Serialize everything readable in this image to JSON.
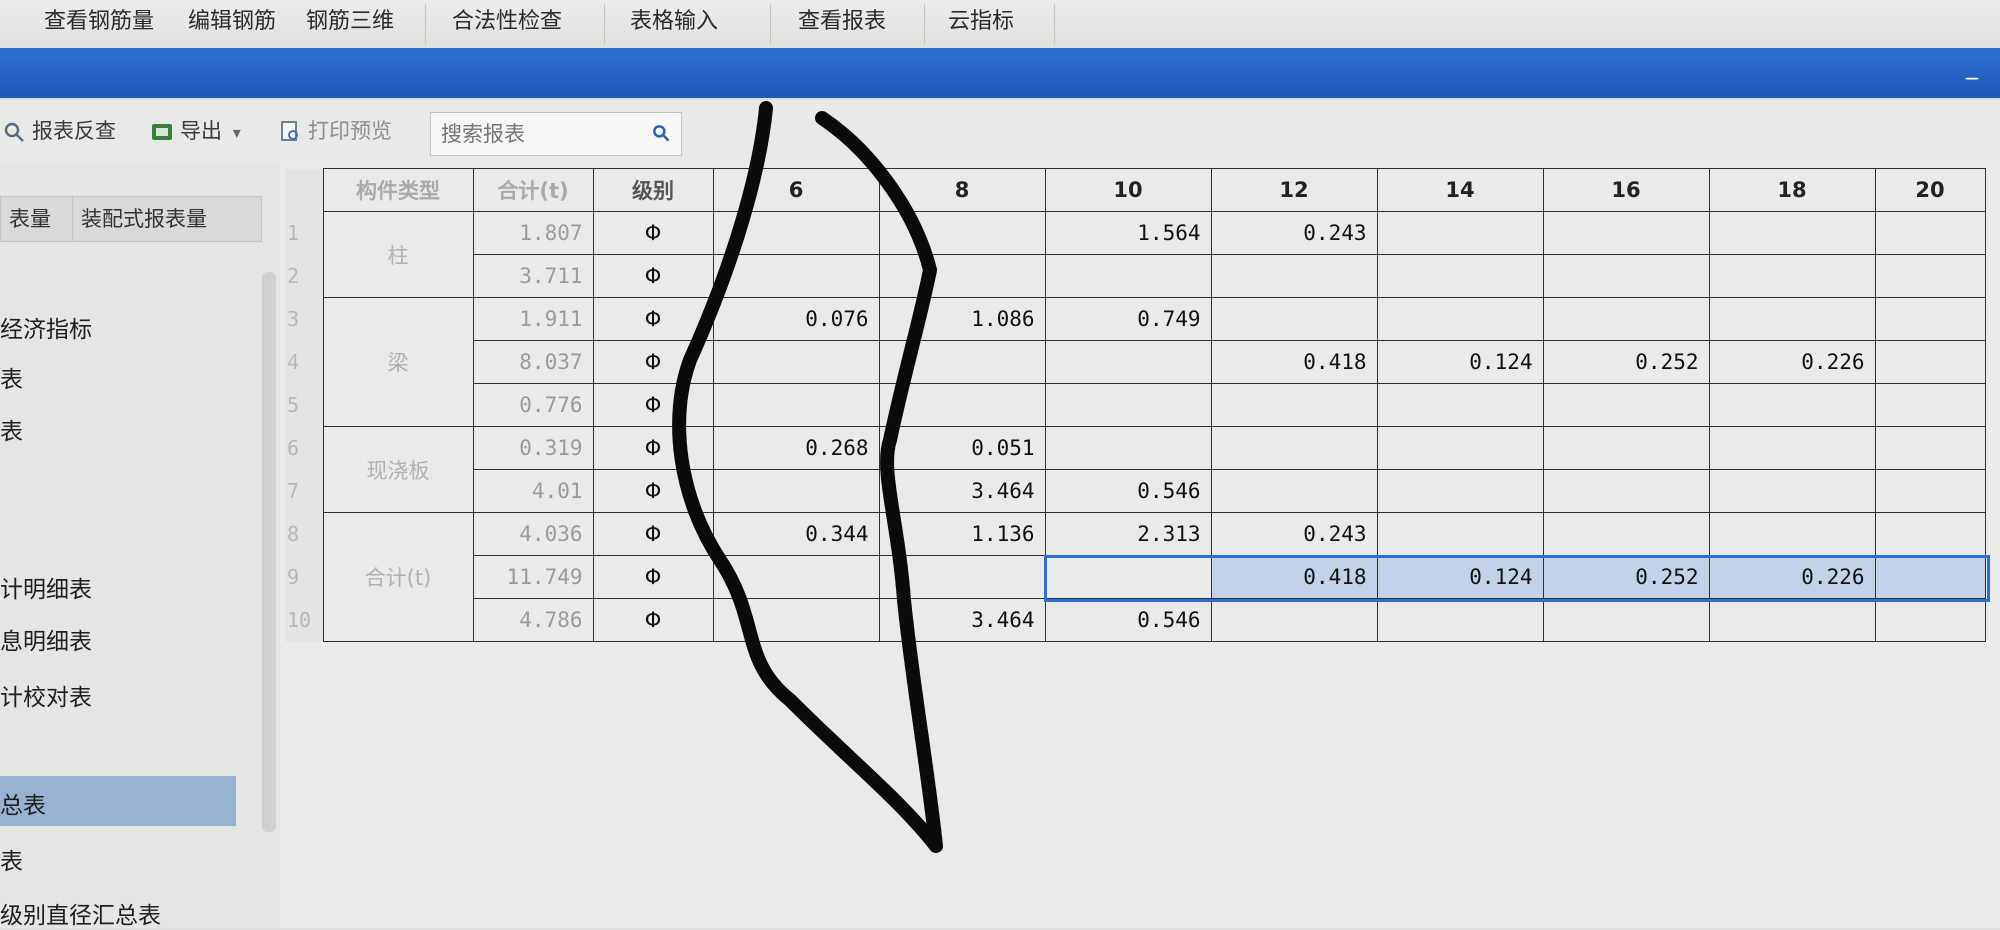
{
  "menu": [
    "查看钢筋量",
    "编辑钢筋",
    "钢筋三维",
    "合法性检查",
    "表格输入",
    "查看报表",
    "云指标"
  ],
  "window": {
    "minimize_label": "_"
  },
  "toolbar": {
    "report_query": "报表反查",
    "export": "导出",
    "export_arrow": "▾",
    "print_preview": "打印预览",
    "search_placeholder": "搜索报表"
  },
  "left_panel": {
    "tabs": [
      "表量",
      "装配式报表量"
    ],
    "items": [
      "经济指标",
      "表",
      "表",
      "计明细表",
      "息明细表",
      "计校对表",
      "总表",
      "表",
      "级别直径汇总表"
    ],
    "selected_index": 6
  },
  "table": {
    "headers": {
      "row_header": "构件类型",
      "total": "合计(t)",
      "grade": "级别",
      "diameters": [
        "6",
        "8",
        "10",
        "12",
        "14",
        "16",
        "18",
        "20"
      ]
    },
    "groups": [
      {
        "name": "柱",
        "first_row": 0,
        "span": 2
      },
      {
        "name": "梁",
        "first_row": 2,
        "span": 3
      },
      {
        "name": "现浇板",
        "first_row": 5,
        "span": 2
      },
      {
        "name": "合计(t)",
        "first_row": 7,
        "span": 3
      }
    ],
    "rows": [
      {
        "num": "1",
        "total": "1.807",
        "grade": "Φ",
        "values": [
          "",
          "",
          "1.564",
          "0.243",
          "",
          "",
          "",
          ""
        ]
      },
      {
        "num": "2",
        "total": "3.711",
        "grade": "Φ",
        "values": [
          "",
          "",
          "",
          "",
          "",
          "",
          "",
          ""
        ]
      },
      {
        "num": "3",
        "total": "1.911",
        "grade": "Φ",
        "values": [
          "0.076",
          "1.086",
          "0.749",
          "",
          "",
          "",
          "",
          ""
        ]
      },
      {
        "num": "4",
        "total": "8.037",
        "grade": "Φ",
        "values": [
          "",
          "",
          "",
          "0.418",
          "0.124",
          "0.252",
          "0.226",
          ""
        ]
      },
      {
        "num": "5",
        "total": "0.776",
        "grade": "Φ",
        "values": [
          "",
          "",
          "",
          "",
          "",
          "",
          "",
          ""
        ]
      },
      {
        "num": "6",
        "total": "0.319",
        "grade": "Φ",
        "values": [
          "0.268",
          "0.051",
          "",
          "",
          "",
          "",
          "",
          ""
        ]
      },
      {
        "num": "7",
        "total": "4.01",
        "grade": "Φ",
        "values": [
          "",
          "3.464",
          "0.546",
          "",
          "",
          "",
          "",
          ""
        ]
      },
      {
        "num": "8",
        "total": "4.036",
        "grade": "Φ",
        "values": [
          "0.344",
          "1.136",
          "2.313",
          "0.243",
          "",
          "",
          "",
          ""
        ]
      },
      {
        "num": "9",
        "total": "11.749",
        "grade": "Φ",
        "values": [
          "",
          "",
          "",
          "0.418",
          "0.124",
          "0.252",
          "0.226",
          ""
        ]
      },
      {
        "num": "10",
        "total": "4.786",
        "grade": "Φ",
        "values": [
          "",
          "3.464",
          "0.546",
          "",
          "",
          "",
          "",
          ""
        ]
      }
    ],
    "selected_row": 8
  },
  "colors": {
    "accent_blue": "#1e58b8",
    "selection": "#2a6fd6",
    "pen": "#0a0a0a"
  }
}
